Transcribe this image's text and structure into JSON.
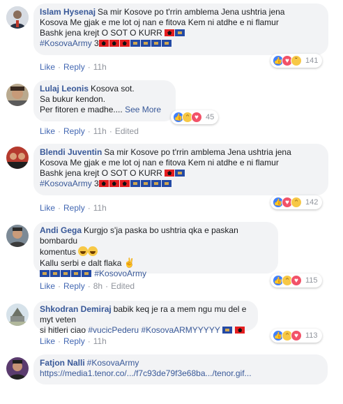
{
  "comments": [
    {
      "name": "Islam Hysenaj",
      "lines": [
        "Sa mir Kosove po t'rrin amblema Jena ushtria jena",
        "Kosova Me gjak e me lot oj nan e fitova Kem ni atdhe e ni flamur",
        "Bashk jena krejt O SOT O KURR"
      ],
      "hashtag": "#KosovaArmy",
      "hashtag_suffix": "3",
      "time": "11h",
      "reaction_count": "141",
      "reactions": [
        "like",
        "love",
        "sad"
      ]
    },
    {
      "name": "Lulaj Leonis",
      "lines": [
        "Kosova sot.",
        "Sa bukur kendon.",
        "Per fitoren e madhe...."
      ],
      "see_more": "See More",
      "time": "11h",
      "edited": "Edited",
      "reaction_count": "45",
      "reactions": [
        "like",
        "haha",
        "love"
      ]
    },
    {
      "name": "Blendi Juventin",
      "lines": [
        "Sa mir Kosove po t'rrin amblema Jena ushtria jena",
        "Kosova Me gjak e me lot oj nan e fitova Kem ni atdhe e ni flamur",
        "Bashk jena krejt O SOT O KURR"
      ],
      "hashtag": "#KosovaArmy",
      "hashtag_suffix": "3",
      "time": "11h",
      "reaction_count": "142",
      "reactions": [
        "like",
        "love",
        "haha"
      ]
    },
    {
      "name": "Andi Gega",
      "lines": [
        "Kurgjo s'ja paska bo ushtria qka e paskan bombardu",
        "komentus",
        "Kallu serbi e dalt flaka"
      ],
      "hashtag": "#KosovoArmy",
      "time": "8h",
      "edited": "Edited",
      "reaction_count": "115",
      "reactions": [
        "like",
        "haha",
        "love"
      ]
    },
    {
      "name": "Shkodran Demiraj",
      "lines": [
        "babik keq je ra a mem ngu mu del e myt veten",
        "si hitleri ciao"
      ],
      "hashtag": "#vucicPederu",
      "hashtag2": "#KosovaARMYYYYY",
      "time": "11h",
      "reaction_count": "113",
      "reactions": [
        "like",
        "haha",
        "love"
      ]
    },
    {
      "name": "Fatjon Nalli",
      "hashtag": "#KosovaArmy",
      "link": "https://media1.tenor.co/.../f7c93de79f3e68ba.../tenor.gif..."
    }
  ],
  "labels": {
    "like": "Like",
    "reply": "Reply"
  },
  "colors": {
    "link": "#385898",
    "bubble": "#f2f3f5",
    "muted": "#90949c"
  }
}
